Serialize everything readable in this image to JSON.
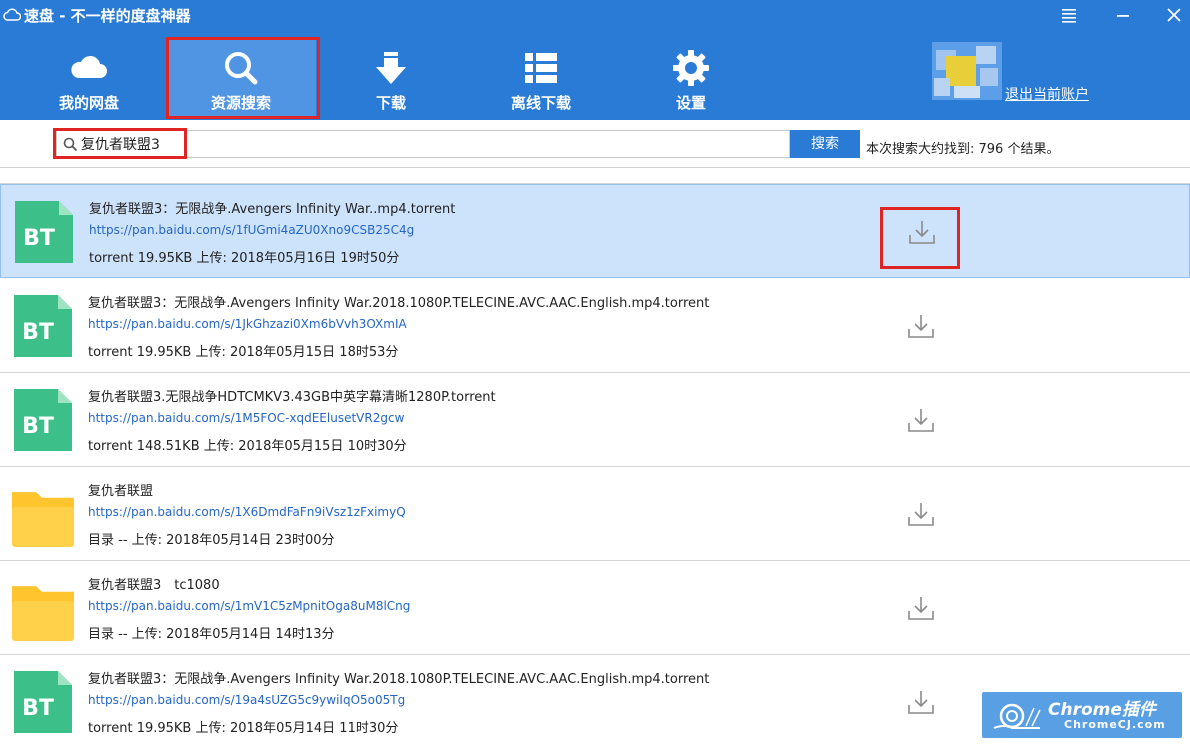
{
  "app": {
    "title": "速盘 - 不一样的度盘神器"
  },
  "nav": {
    "items": [
      {
        "label": "我的网盘",
        "icon": "cloud-icon"
      },
      {
        "label": "资源搜索",
        "icon": "search-icon",
        "active": true
      },
      {
        "label": "下载",
        "icon": "download-arrow-icon"
      },
      {
        "label": "离线下载",
        "icon": "list-icon"
      },
      {
        "label": "设置",
        "icon": "gear-icon"
      }
    ]
  },
  "account": {
    "logout_label": "退出当前账户"
  },
  "search": {
    "value": "复仇者联盟3",
    "button_label": "搜索",
    "result_summary": "本次搜索大约找到: 796 个结果。"
  },
  "results": [
    {
      "type": "BT",
      "name": "复仇者联盟3：无限战争.Avengers Infinity War..mp4.torrent",
      "url": "https://pan.baidu.com/s/1fUGmi4aZU0Xno9CSB25C4g",
      "meta": "torrent 19.95KB 上传: 2018年05月16日 19时50分",
      "selected": true
    },
    {
      "type": "BT",
      "name": "复仇者联盟3：无限战争.Avengers Infinity War.2018.1080P.TELECINE.AVC.AAC.English.mp4.torrent",
      "url": "https://pan.baidu.com/s/1JkGhzazi0Xm6bVvh3OXmIA",
      "meta": "torrent 19.95KB 上传: 2018年05月15日 18时53分"
    },
    {
      "type": "BT",
      "name": "复仇者联盟3.无限战争HDTCMKV3.43GB中英字幕清晰1280P.torrent",
      "url": "https://pan.baidu.com/s/1M5FOC-xqdEElusetVR2gcw",
      "meta": "torrent 148.51KB 上传: 2018年05月15日 10时30分"
    },
    {
      "type": "folder",
      "name": "复仇者联盟",
      "url": "https://pan.baidu.com/s/1X6DmdFaFn9iVsz1zFximyQ",
      "meta": "目录 -- 上传: 2018年05月14日 23时00分"
    },
    {
      "type": "folder",
      "name": "复仇者联盟3　tc1080",
      "url": "https://pan.baidu.com/s/1mV1C5zMpnitOga8uM8lCng",
      "meta": "目录 -- 上传: 2018年05月14日 14时13分"
    },
    {
      "type": "BT",
      "name": "复仇者联盟3：无限战争.Avengers Infinity War.2018.1080P.TELECINE.AVC.AAC.English.mp4.torrent",
      "url": "https://pan.baidu.com/s/19a4sUZG5c9ywiIqO5o05Tg",
      "meta": "torrent 19.95KB 上传: 2018年05月14日 11时30分"
    }
  ],
  "watermark": {
    "title": "Chrome插件",
    "subtitle": "ChromeCJ.com"
  },
  "colors": {
    "header_bg": "#2a7bd6",
    "nav_active_bg": "#4f95e3",
    "selected_row_bg": "#cde3fb",
    "bt_icon": "#3dbf8a",
    "folder_icon": "#ffd04a",
    "link": "#2566c6",
    "highlight_box": "#e02424"
  }
}
